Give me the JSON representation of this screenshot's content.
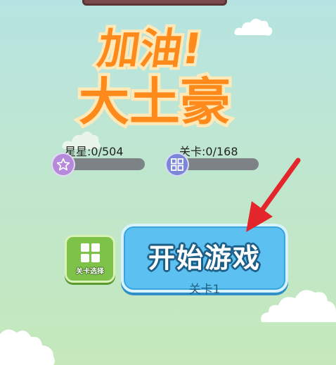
{
  "title": {
    "line1": "加油!",
    "line2": "大土豪"
  },
  "stats": {
    "stars": {
      "label": "星星:",
      "value": "0/504",
      "progress": 0
    },
    "levels": {
      "label": "关卡:",
      "value": "0/168",
      "progress": 0
    }
  },
  "buttons": {
    "level_select_label": "关卡选择",
    "start_label": "开始游戏",
    "start_sublabel": "关卡1"
  },
  "colors": {
    "title_orange": "#ff8a1c",
    "start_button": "#5cc0f0",
    "level_select_button": "#7ec24a",
    "star_badge": "#b48ad9",
    "level_badge": "#7b86d8",
    "arrow": "#e3262b"
  },
  "icons": [
    "star-icon",
    "grid-icon",
    "arrow-icon",
    "cloud-icon"
  ]
}
